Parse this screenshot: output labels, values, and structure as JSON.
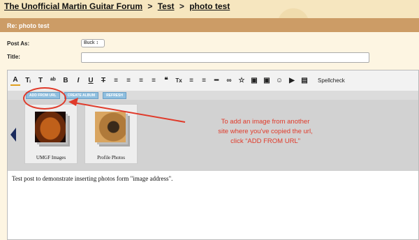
{
  "breadcrumb": {
    "forum": "The Unofficial Martin Guitar Forum",
    "section": "Test",
    "current": "photo test",
    "separator": ">"
  },
  "panel": {
    "header": "Re: photo test",
    "post_as_label": "Post As:",
    "post_as_value": "Buck ↕",
    "title_label": "Title:",
    "title_value": ""
  },
  "toolbar": {
    "buttons": [
      "A",
      "Tᵢ",
      "T",
      "ᵃᵇ",
      "B",
      "I",
      "U",
      "T",
      "≡",
      "≡",
      "≡",
      "≡",
      "❝",
      "Tx",
      "≡",
      "≡",
      "━",
      "∞",
      "☆",
      "▣",
      "▣",
      "☺",
      "▶",
      "▤"
    ],
    "spellcheck": "Spellcheck"
  },
  "picture_bar": {
    "add_from_url": "ADD FROM URL",
    "create_album": "CREATE ALBUM",
    "refresh": "REFRESH"
  },
  "albums": [
    {
      "caption": "UMGF Images"
    },
    {
      "caption": "Profile Photos"
    }
  ],
  "editor": {
    "body": "Test post to demonstrate inserting photos form \"image address\"."
  },
  "annotation": {
    "line1": "To add an image from another",
    "line2": "site where you've copied the url,",
    "line3": "click “ADD FROM URL”"
  },
  "colors": {
    "header": "#cc9c66",
    "annotation": "#e03a2a",
    "button": "#8fbfdf"
  }
}
